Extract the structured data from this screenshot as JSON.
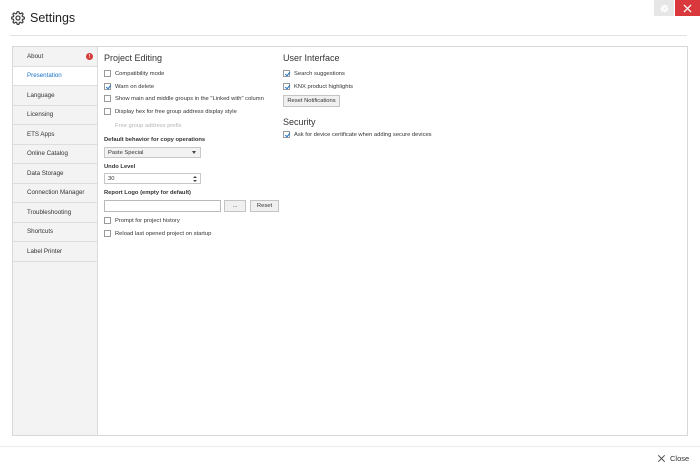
{
  "window": {
    "title": "Settings",
    "icons": {
      "title": "gear-icon",
      "settings_button": "gear-icon",
      "close_button": "close-icon"
    },
    "colors": {
      "close_button": "#d9393c",
      "accent": "#1a73c8",
      "badge": "#d43a3a"
    }
  },
  "sidebar": {
    "items": [
      {
        "label": "About",
        "badge": "!"
      },
      {
        "label": "Presentation",
        "active": true
      },
      {
        "label": "Language"
      },
      {
        "label": "Licensing"
      },
      {
        "label": "ETS Apps"
      },
      {
        "label": "Online Catalog"
      },
      {
        "label": "Data Storage"
      },
      {
        "label": "Connection Manager"
      },
      {
        "label": "Troubleshooting"
      },
      {
        "label": "Shortcuts"
      },
      {
        "label": "Label Printer"
      }
    ]
  },
  "project_editing": {
    "title": "Project Editing",
    "compatibility_mode": {
      "label": "Compatibility mode",
      "checked": false
    },
    "warn_on_delete": {
      "label": "Warn on delete",
      "checked": true
    },
    "show_main_middle": {
      "label": "Show main and middle groups in the \"Linked with\" column",
      "checked": false
    },
    "display_hex": {
      "label": "Display hex for free group address display style",
      "checked": false
    },
    "free_group_prefix": {
      "label": "Free group address prefix"
    },
    "default_behavior": {
      "label": "Default behavior for copy operations",
      "value": "Paste Special"
    },
    "undo_level": {
      "label": "Undo Level",
      "value": "30"
    },
    "report_logo": {
      "label": "Report Logo (empty for default)",
      "value": "",
      "browse_label": "...",
      "reset_label": "Reset"
    },
    "prompt_history": {
      "label": "Prompt for project history",
      "checked": false
    },
    "reload_last": {
      "label": "Reload last opened project on startup",
      "checked": false
    }
  },
  "user_interface": {
    "title": "User Interface",
    "search_suggestions": {
      "label": "Search suggestions",
      "checked": true
    },
    "knx_highlights": {
      "label": "KNX product highlights",
      "checked": true
    },
    "reset_notifications_label": "Reset Notifications"
  },
  "security": {
    "title": "Security",
    "ask_certificate": {
      "label": "Ask for device certificate when adding secure devices",
      "checked": true
    }
  },
  "footer": {
    "close_label": "Close",
    "icon": "close-icon"
  }
}
